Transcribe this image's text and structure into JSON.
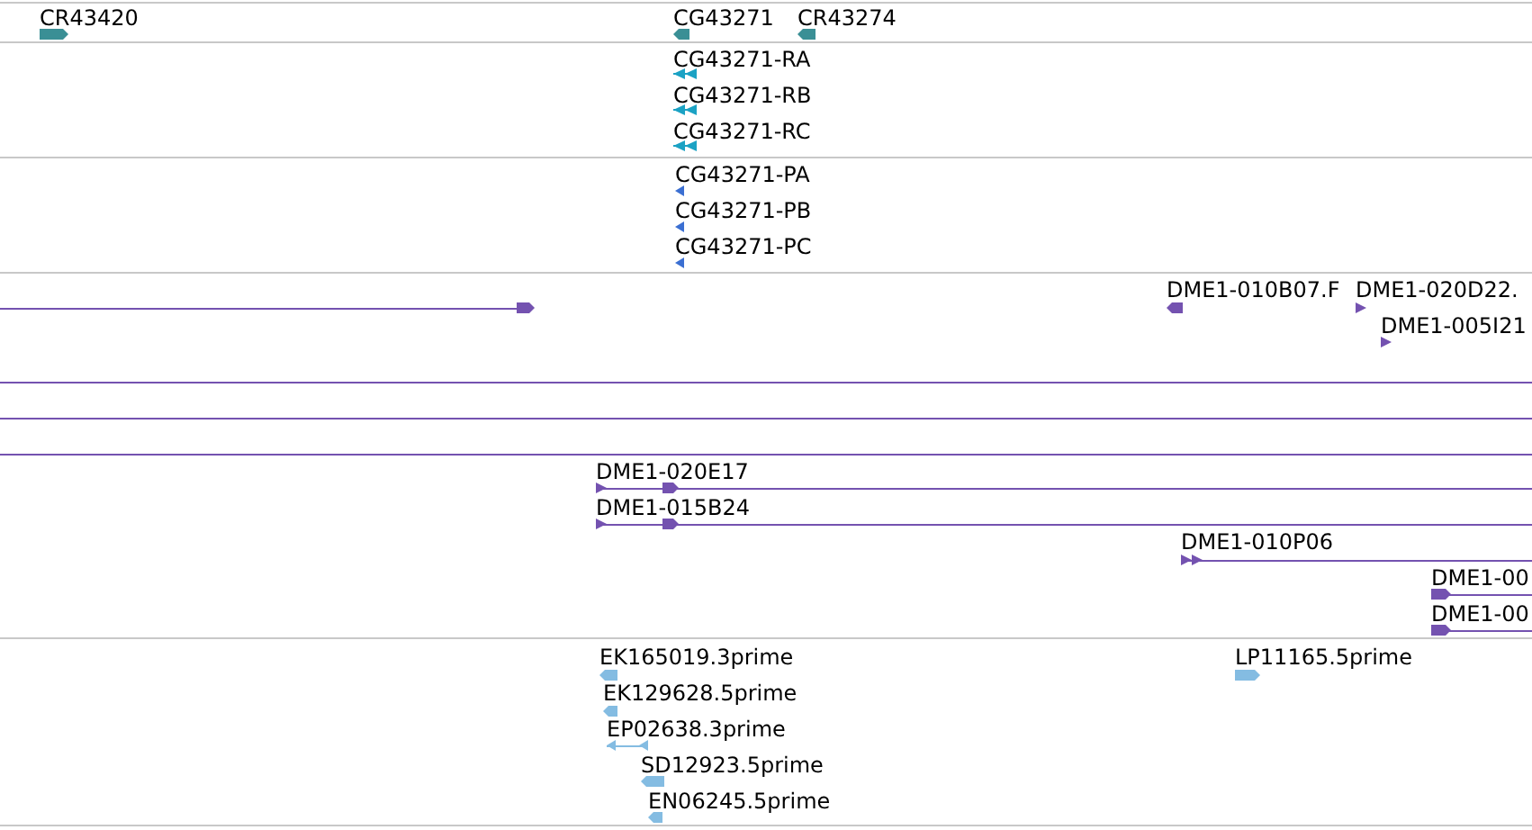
{
  "tracks": [
    {
      "color": "#3a8f95",
      "features": [
        {
          "kind": "feature",
          "label": "CR43420",
          "reverse": false
        },
        {
          "kind": "feature",
          "label": "CG43271",
          "reverse": true
        },
        {
          "kind": "feature",
          "label": "CR43274",
          "reverse": true
        }
      ]
    },
    {
      "color": "#1ba2c4",
      "features": [
        {
          "kind": "feature",
          "label": "CG43271-RA",
          "reverse": true
        },
        {
          "kind": "feature",
          "label": "CG43271-RB",
          "reverse": true
        },
        {
          "kind": "feature",
          "label": "CG43271-RC",
          "reverse": true
        }
      ]
    },
    {
      "color": "#3b6fd2",
      "features": [
        {
          "kind": "feature",
          "label": "CG43271-PA",
          "reverse": true
        },
        {
          "kind": "feature",
          "label": "CG43271-PB",
          "reverse": true
        },
        {
          "kind": "feature",
          "label": "CG43271-PC",
          "reverse": true
        }
      ]
    },
    {
      "color": "#7452b0",
      "features": [
        {
          "kind": "feature",
          "reverse": false
        },
        {
          "kind": "feature",
          "label": "DME1-010B07.F",
          "reverse": true
        },
        {
          "kind": "feature",
          "label": "DME1-020D22.",
          "reverse": false
        },
        {
          "kind": "feature",
          "label": "DME1-005I21",
          "reverse": false
        },
        {
          "kind": "span"
        },
        {
          "kind": "span"
        },
        {
          "kind": "span"
        },
        {
          "kind": "feature",
          "label": "DME1-020E17",
          "reverse": false
        },
        {
          "kind": "feature",
          "label": "DME1-015B24",
          "reverse": false
        },
        {
          "kind": "feature",
          "label": "DME1-010P06",
          "reverse": false
        },
        {
          "kind": "feature",
          "label": "DME1-00",
          "reverse": false
        },
        {
          "kind": "feature",
          "label": "DME1-00",
          "reverse": false
        }
      ]
    },
    {
      "color": "#84bce2",
      "features": [
        {
          "kind": "feature",
          "label": "EK165019.3prime",
          "reverse": true
        },
        {
          "kind": "feature",
          "label": "EK129628.5prime",
          "reverse": true
        },
        {
          "kind": "feature",
          "label": "EP02638.3prime",
          "reverse": true
        },
        {
          "kind": "feature",
          "label": "SD12923.5prime",
          "reverse": true
        },
        {
          "kind": "feature",
          "label": "EN06245.5prime",
          "reverse": true
        },
        {
          "kind": "feature",
          "label": "LP11165.5prime",
          "reverse": false
        }
      ]
    }
  ]
}
